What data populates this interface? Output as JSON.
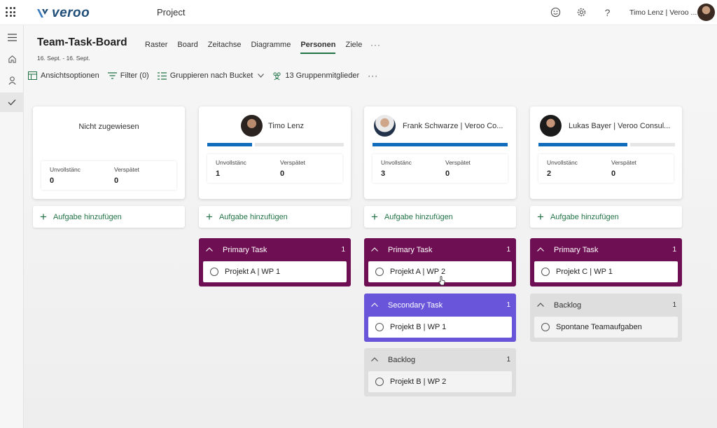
{
  "topbar": {
    "logo": "veroo",
    "app_title": "Project",
    "user": "Timo Lenz | Veroo ...",
    "icons": [
      "waffle-icon",
      "smiley-icon",
      "gear-icon",
      "help-icon"
    ]
  },
  "board": {
    "title": "Team-Task-Board",
    "date_range": "16. Sept. - 16. Sept.",
    "tabs": [
      {
        "label": "Raster",
        "active": false
      },
      {
        "label": "Board",
        "active": false
      },
      {
        "label": "Zeitachse",
        "active": false
      },
      {
        "label": "Diagramme",
        "active": false
      },
      {
        "label": "Personen",
        "active": true
      },
      {
        "label": "Ziele",
        "active": false
      }
    ],
    "more": "···"
  },
  "toolbar": {
    "view_options": "Ansichtsoptionen",
    "filter": "Filter (0)",
    "group": "Gruppieren nach Bucket",
    "members": "13 Gruppenmitglieder",
    "more": "···"
  },
  "labels": {
    "incomplete": "Unvollstänc",
    "late": "Verspätet",
    "add_task": "Aufgabe hinzufügen"
  },
  "columns": [
    {
      "name": "Nicht zugewiesen",
      "incomplete": "0",
      "late": "0",
      "progress": null,
      "buckets": []
    },
    {
      "name": "Timo Lenz",
      "incomplete": "1",
      "late": "0",
      "progress": 0.34,
      "buckets": [
        {
          "name": "Primary Task",
          "count": "1",
          "style": "primary",
          "tasks": [
            "Projekt A | WP 1"
          ]
        }
      ]
    },
    {
      "name": "Frank Schwarze | Veroo Co...",
      "incomplete": "3",
      "late": "0",
      "progress": 1.0,
      "buckets": [
        {
          "name": "Primary Task",
          "count": "1",
          "style": "primary",
          "tasks": [
            "Projekt A | WP 2"
          ]
        },
        {
          "name": "Secondary Task",
          "count": "1",
          "style": "secondary",
          "tasks": [
            "Projekt B | WP 1"
          ]
        },
        {
          "name": "Backlog",
          "count": "1",
          "style": "backlog",
          "tasks": [
            "Projekt B | WP 2"
          ]
        }
      ]
    },
    {
      "name": "Lukas Bayer | Veroo Consul...",
      "incomplete": "2",
      "late": "0",
      "progress": 0.66,
      "buckets": [
        {
          "name": "Primary Task",
          "count": "1",
          "style": "primary",
          "tasks": [
            "Projekt C | WP 1"
          ]
        },
        {
          "name": "Backlog",
          "count": "1",
          "style": "backlog",
          "tasks": [
            "Spontane Teamaufgaben"
          ]
        }
      ]
    }
  ],
  "colors": {
    "primary_bucket": "#6f0f53",
    "secondary_bucket": "#6855d9",
    "backlog_bucket": "#dedede",
    "accent_green": "#217346",
    "progress_blue": "#0f6cbd"
  }
}
